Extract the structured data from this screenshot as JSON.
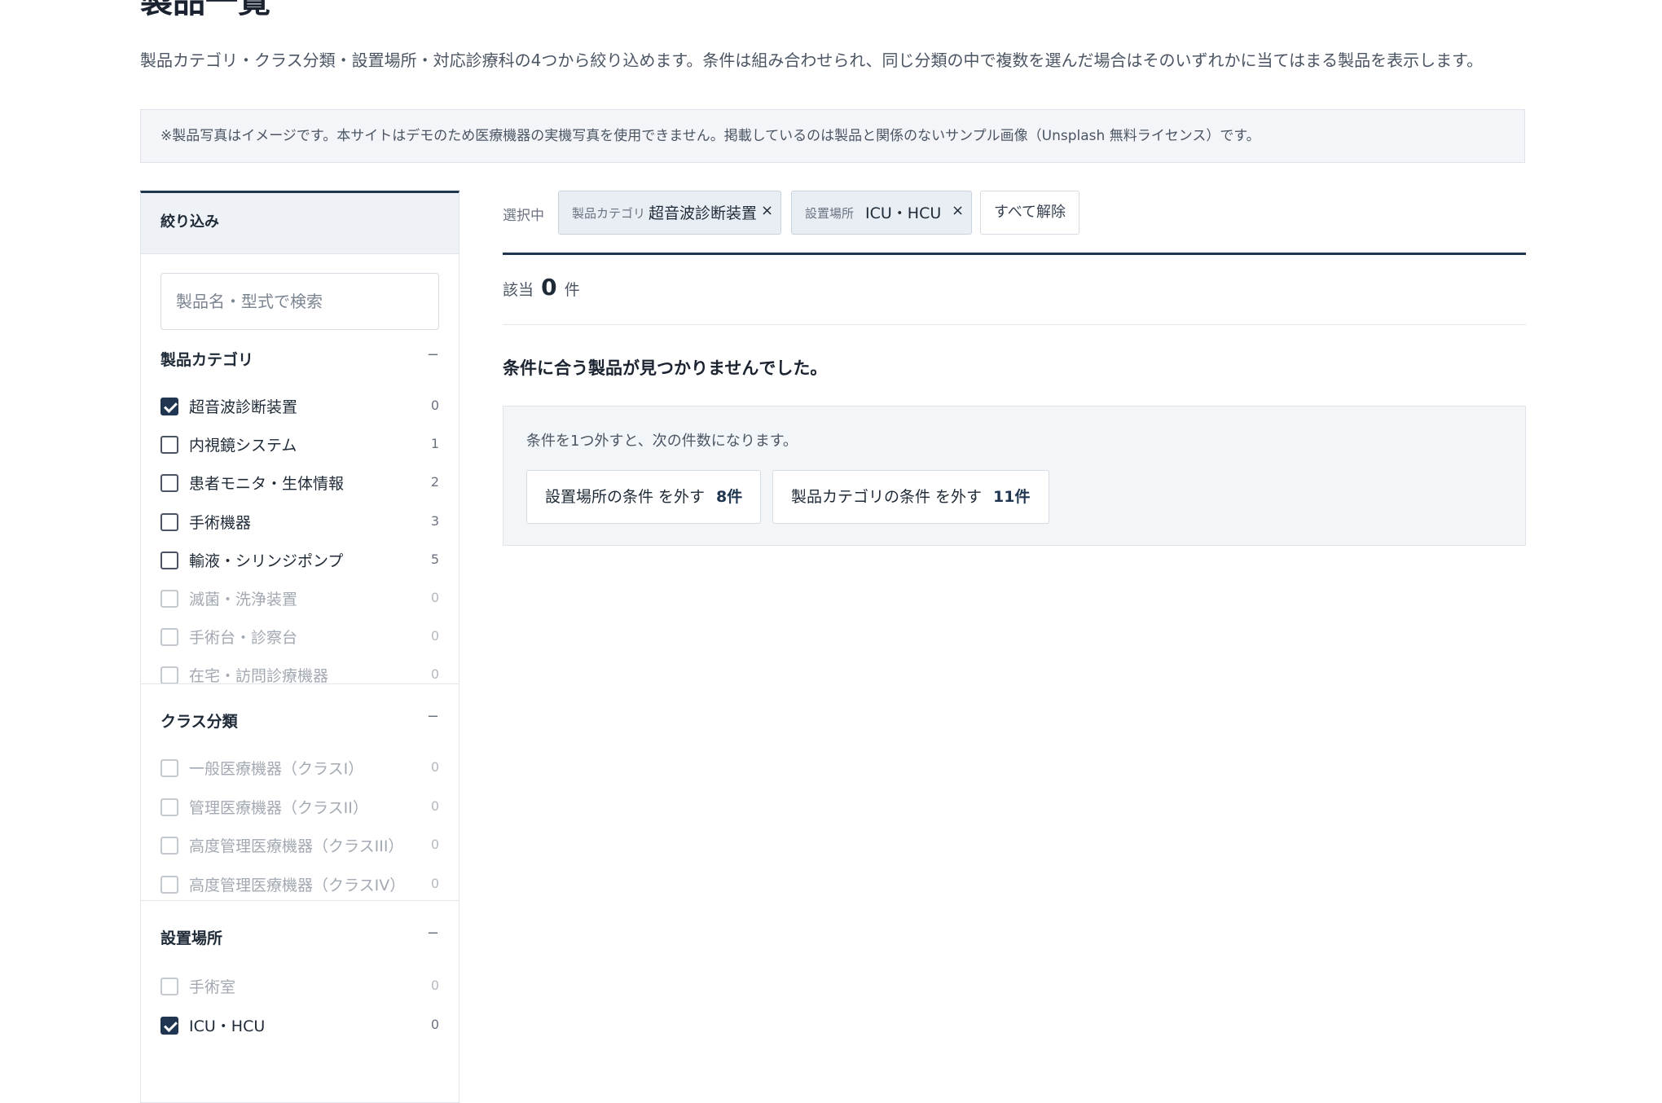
{
  "page": {
    "title": "製品一覧",
    "description": "製品カテゴリ・クラス分類・設置場所・対応診療科の4つから絞り込めます。条件は組み合わせられ、同じ分類の中で複数を選んだ場合はそのいずれかに当てはまる製品を表示します。",
    "notice": "※製品写真はイメージです。本サイトはデモのため医療機器の実機写真を使用できません。掲載しているのは製品と関係のないサンプル画像（Unsplash 無料ライセンス）です。"
  },
  "sidebar": {
    "title": "絞り込み",
    "search_placeholder": "製品名・型式で検索",
    "groups": [
      {
        "title": "製品カテゴリ",
        "toggle": "−",
        "items": [
          {
            "label": "超音波診断装置",
            "count": "0",
            "checked": true,
            "disabled": false
          },
          {
            "label": "内視鏡システム",
            "count": "1",
            "checked": false,
            "disabled": false
          },
          {
            "label": "患者モニタ・生体情報",
            "count": "2",
            "checked": false,
            "disabled": false
          },
          {
            "label": "手術機器",
            "count": "3",
            "checked": false,
            "disabled": false
          },
          {
            "label": "輸液・シリンジポンプ",
            "count": "5",
            "checked": false,
            "disabled": false
          },
          {
            "label": "滅菌・洗浄装置",
            "count": "0",
            "checked": false,
            "disabled": true
          },
          {
            "label": "手術台・診察台",
            "count": "0",
            "checked": false,
            "disabled": true
          },
          {
            "label": "在宅・訪問診療機器",
            "count": "0",
            "checked": false,
            "disabled": true
          }
        ]
      },
      {
        "title": "クラス分類",
        "toggle": "−",
        "items": [
          {
            "label": "一般医療機器（クラスI）",
            "count": "0",
            "checked": false,
            "disabled": true
          },
          {
            "label": "管理医療機器（クラスII）",
            "count": "0",
            "checked": false,
            "disabled": true
          },
          {
            "label": "高度管理医療機器（クラスIII）",
            "count": "0",
            "checked": false,
            "disabled": true
          },
          {
            "label": "高度管理医療機器（クラスIV）",
            "count": "0",
            "checked": false,
            "disabled": true
          }
        ]
      },
      {
        "title": "設置場所",
        "toggle": "−",
        "items": [
          {
            "label": "手術室",
            "count": "0",
            "checked": false,
            "disabled": true
          },
          {
            "label": "ICU・HCU",
            "count": "0",
            "checked": true,
            "disabled": false
          }
        ]
      }
    ]
  },
  "selected": {
    "label": "選択中",
    "chips": [
      {
        "category": "製品カテゴリ",
        "value": "超音波診断装置",
        "remove": "×"
      },
      {
        "category": "設置場所",
        "value": "ICU・HCU",
        "remove": "×"
      }
    ],
    "clear_all": "すべて解除"
  },
  "results": {
    "prefix": "該当",
    "count": "0",
    "suffix": "件",
    "empty_title": "条件に合う製品が見つかりませんでした。",
    "suggestion_text": "条件を1つ外すと、次の件数になります。",
    "suggestions": [
      {
        "label": "設置場所の条件 を外す",
        "count": "8件"
      },
      {
        "label": "製品カテゴリの条件 を外す",
        "count": "11件"
      }
    ]
  },
  "colors": {
    "accent": "#1f3550",
    "notice_bg": "#f3f5f8",
    "chip_bg": "#e9eef4"
  }
}
